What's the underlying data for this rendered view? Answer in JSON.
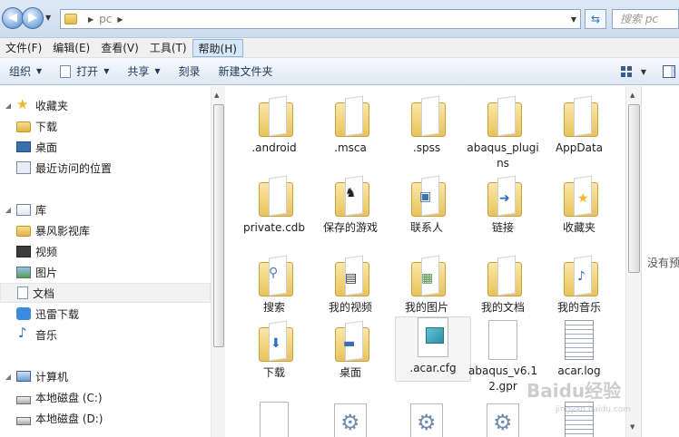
{
  "address": {
    "path_segment": "pc",
    "search_placeholder": "搜索 pc"
  },
  "menu": [
    "文件(F)",
    "编辑(E)",
    "查看(V)",
    "工具(T)",
    "帮助(H)"
  ],
  "toolbar": {
    "organize": "组织",
    "open": "打开",
    "share": "共享",
    "burn": "刻录",
    "new_folder": "新建文件夹"
  },
  "nav": {
    "favorites": "收藏夹",
    "downloads": "下载",
    "desktop": "桌面",
    "recent": "最近访问的位置",
    "libraries": "库",
    "storm": "暴风影视库",
    "videos": "视频",
    "pictures": "图片",
    "documents": "文档",
    "thunder": "迅雷下载",
    "music": "音乐",
    "computer": "计算机",
    "disk_c": "本地磁盘 (C:)",
    "disk_d": "本地磁盘 (D:)"
  },
  "files": [
    {
      "label": ".android"
    },
    {
      "label": ".msca"
    },
    {
      "label": ".spss"
    },
    {
      "label": "abaqus_plugins"
    },
    {
      "label": "AppData"
    },
    {
      "label": "private.cdb"
    },
    {
      "label": "保存的游戏"
    },
    {
      "label": "联系人"
    },
    {
      "label": "链接"
    },
    {
      "label": "收藏夹"
    },
    {
      "label": "搜索"
    },
    {
      "label": "我的视频"
    },
    {
      "label": "我的图片"
    },
    {
      "label": "我的文档"
    },
    {
      "label": "我的音乐"
    },
    {
      "label": "下载"
    },
    {
      "label": "桌面"
    },
    {
      "label": ".acar.cfg"
    },
    {
      "label": "abaqus_v6.12.gpr"
    },
    {
      "label": "acar.log"
    }
  ],
  "preview": {
    "text": "没有预"
  },
  "watermark": {
    "brand": "Baidu经验",
    "url": "jingyan.baidu.com"
  }
}
